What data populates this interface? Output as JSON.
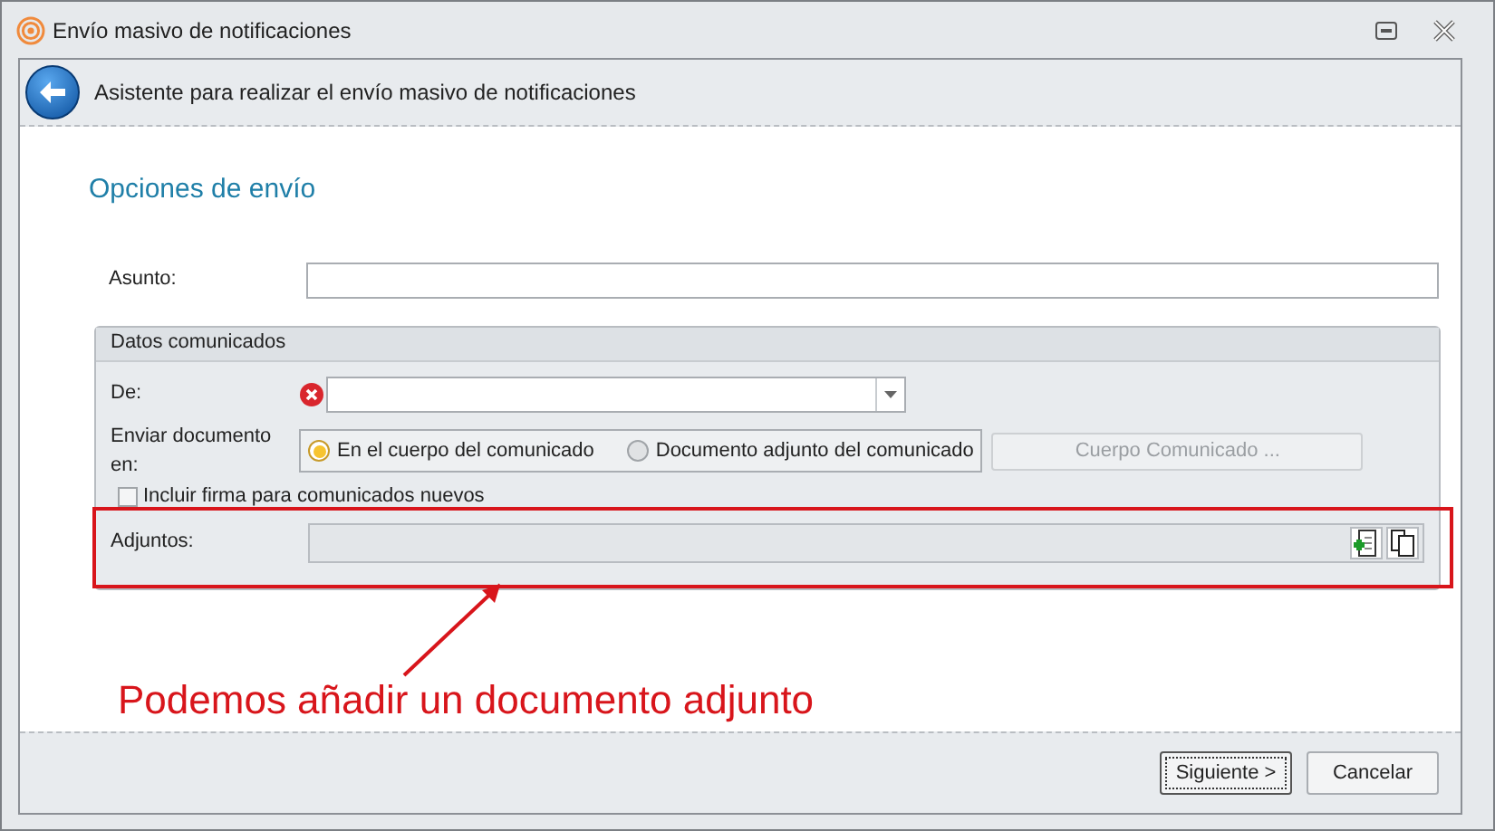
{
  "window": {
    "title": "Envío masivo de notificaciones"
  },
  "header": {
    "title": "Asistente para realizar el envío masivo de notificaciones"
  },
  "section_title": "Opciones de envío",
  "asunto": {
    "label": "Asunto:"
  },
  "group": {
    "title": "Datos comunicados",
    "de": {
      "label": "De:",
      "error": true
    },
    "enviar": {
      "label": "Enviar documento en:",
      "options": [
        {
          "label": "En el cuerpo del comunicado",
          "selected": true
        },
        {
          "label": "Documento adjunto del comunicado",
          "selected": false
        }
      ]
    },
    "cuerpo_button": {
      "label": "Cuerpo Comunicado ...",
      "disabled": true
    },
    "firma": {
      "label": "Incluir firma para comunicados nuevos",
      "checked": false
    },
    "adjuntos": {
      "label": "Adjuntos:"
    }
  },
  "annotation": {
    "text": "Podemos añadir un documento adjunto"
  },
  "buttons": [
    {
      "label": "Siguiente >",
      "focused": true
    },
    {
      "label": "Cancelar",
      "focused": false
    }
  ]
}
